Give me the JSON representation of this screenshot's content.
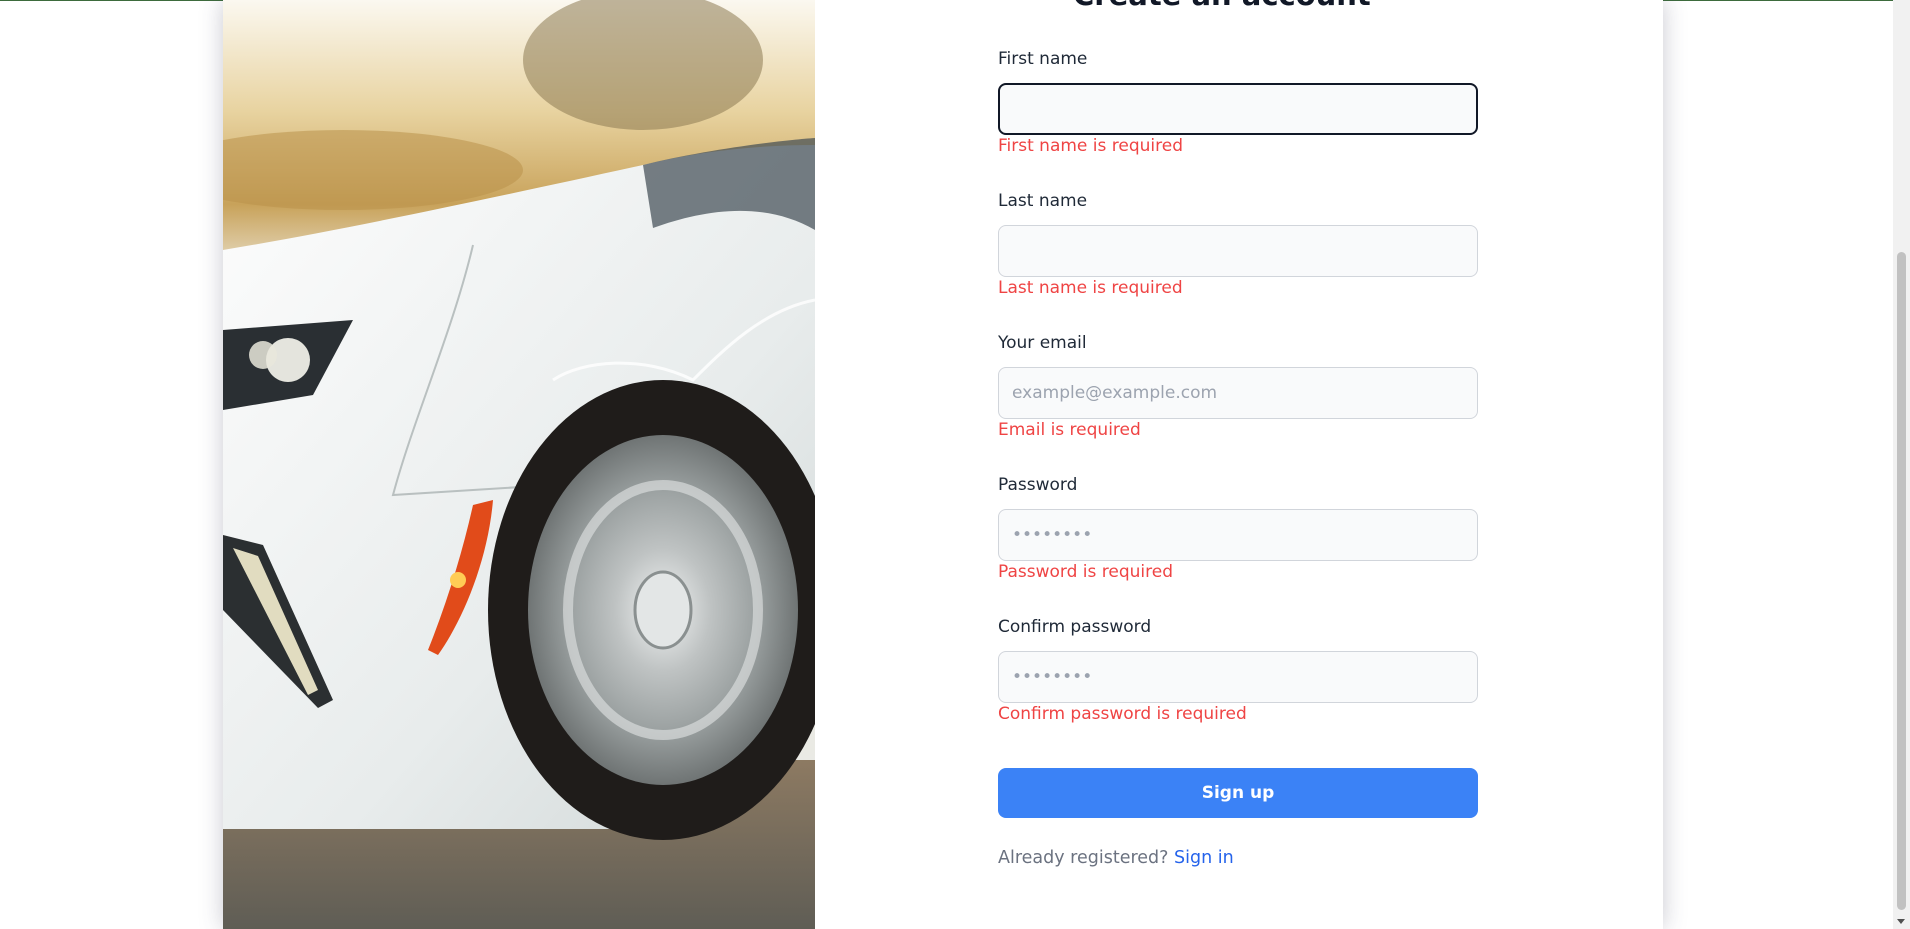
{
  "page": {
    "title": "Create an account"
  },
  "form": {
    "fields": [
      {
        "label": "First name",
        "value": "",
        "placeholder": "",
        "error": "First name is required"
      },
      {
        "label": "Last name",
        "value": "",
        "placeholder": "",
        "error": "Last name is required"
      },
      {
        "label": "Your email",
        "value": "",
        "placeholder": "example@example.com",
        "error": "Email is required"
      },
      {
        "label": "Password",
        "value": "",
        "placeholder": "••••••••",
        "error": "Password is required"
      },
      {
        "label": "Confirm password",
        "value": "",
        "placeholder": "••••••••",
        "error": "Confirm password is required"
      }
    ],
    "submit_label": "Sign up",
    "footer_text": "Already registered?",
    "footer_link": "Sign in"
  },
  "colors": {
    "accent": "#3b82f6",
    "error": "#ef4444",
    "link": "#2563eb"
  },
  "icons": {
    "hero": "car-photo"
  }
}
